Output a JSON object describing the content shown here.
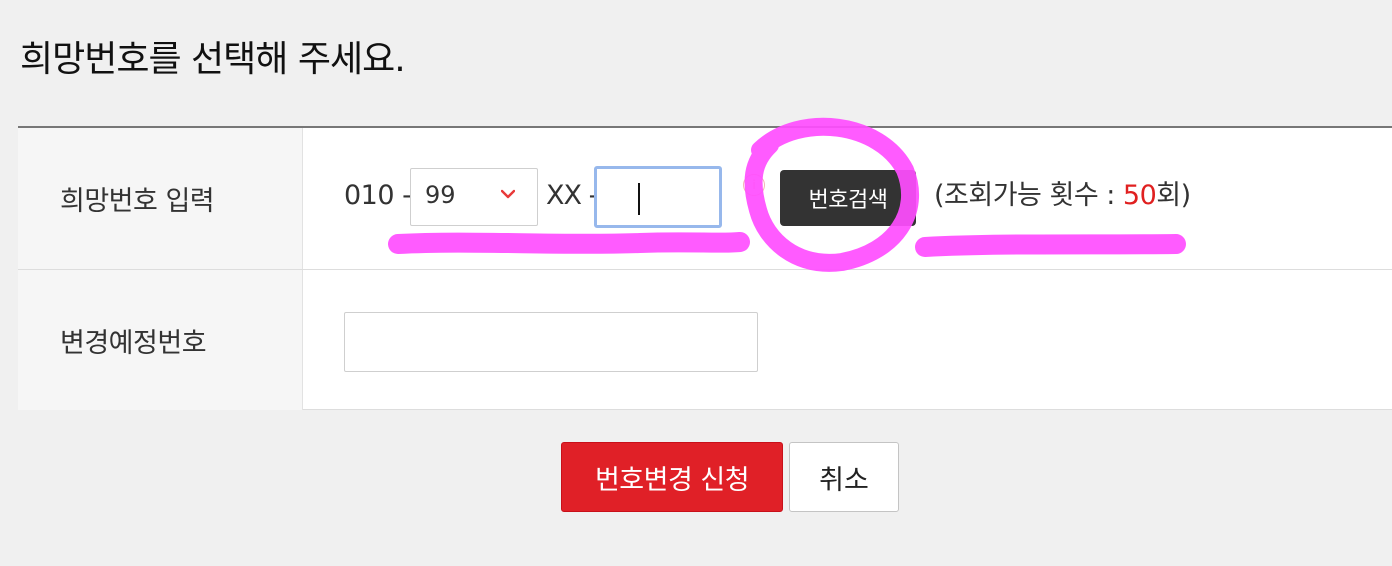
{
  "page_title": "희망번호를 선택해 주세요.",
  "rows": {
    "desired_number": {
      "label": "희망번호 입력",
      "prefix": "010 -",
      "area_select": {
        "selected": "99"
      },
      "middle_text": "XX -",
      "last_digits_input": {
        "value": ""
      },
      "search_button_label": "번호검색",
      "query_count": {
        "prefix": "(조회가능 횟수 : ",
        "count": "50",
        "suffix": "회)"
      }
    },
    "scheduled_number": {
      "label": "변경예정번호",
      "input_value": ""
    }
  },
  "actions": {
    "apply_label": "번호변경 신청",
    "cancel_label": "취소"
  },
  "colors": {
    "primary_red": "#e02027",
    "highlight_marker": "#ff4dff",
    "focus_border": "#97b8ec",
    "dark_button": "#333333"
  },
  "icons": {
    "dropdown": "chevron-down-icon",
    "info": "info-icon"
  }
}
